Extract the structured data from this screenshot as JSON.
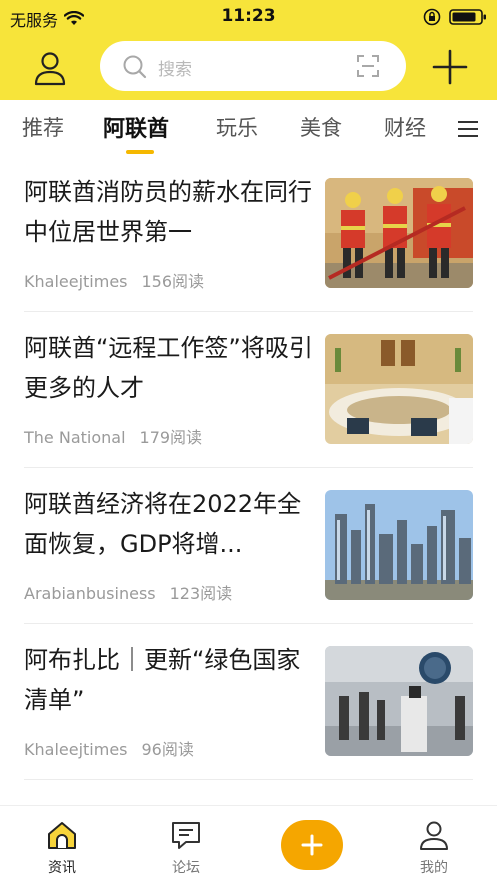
{
  "status_bar": {
    "carrier": "无服务",
    "time": "11:23"
  },
  "search": {
    "placeholder": "搜索"
  },
  "tabs": [
    {
      "label": "推荐",
      "active": false
    },
    {
      "label": "阿联酋",
      "active": true
    },
    {
      "label": "玩乐",
      "active": false
    },
    {
      "label": "美食",
      "active": false
    },
    {
      "label": "财经",
      "active": false
    }
  ],
  "articles": [
    {
      "title": "阿联酋消防员的薪水在同行中位居世界第一",
      "source": "Khaleejtimes",
      "reads": "156阅读",
      "thumb_icon": "firefighters-photo"
    },
    {
      "title": "阿联酋“远程工作签”将吸引更多的人才",
      "source": "The National",
      "reads": "179阅读",
      "thumb_icon": "meeting-room-photo"
    },
    {
      "title": "阿联酋经济将在2022年全面恢复，GDP将增...",
      "source": "Arabianbusiness",
      "reads": "123阅读",
      "thumb_icon": "city-skyline-photo"
    },
    {
      "title": "阿布扎比｜更新“绿色国家清单”",
      "source": "Khaleejtimes",
      "reads": "96阅读",
      "thumb_icon": "airport-photo"
    }
  ],
  "bottom_nav": [
    {
      "label": "资讯",
      "icon": "home-icon",
      "active": true
    },
    {
      "label": "论坛",
      "icon": "forum-icon",
      "active": false
    },
    {
      "label": "我的",
      "icon": "profile-icon",
      "active": false
    }
  ],
  "colors": {
    "header_yellow": "#f7e43a",
    "accent_orange": "#f5a600",
    "indicator": "#f5b800"
  }
}
